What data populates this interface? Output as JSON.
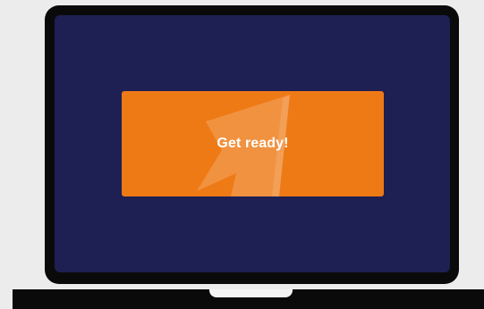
{
  "banner": {
    "message": "Get ready!",
    "icon": "flag-logo-icon"
  },
  "colors": {
    "page_background": "#ececec",
    "laptop_frame": "#0a0a0a",
    "screen_background": "#1e1f52",
    "banner_background": "#ee7a16",
    "banner_text": "#ffffff"
  }
}
